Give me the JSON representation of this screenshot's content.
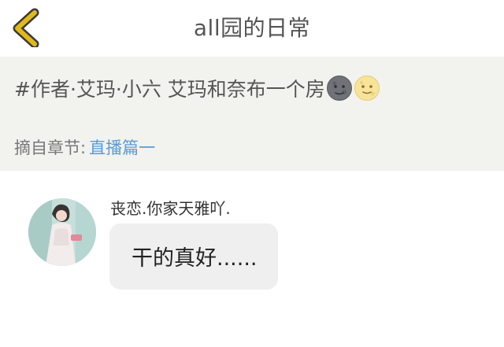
{
  "header": {
    "title": "all园的日常",
    "back_icon": "chevron-left-icon",
    "accent_color": "#e2b81a"
  },
  "quote": {
    "text": "#作者·艾玛·小六 艾玛和奈布一个房",
    "emojis": [
      "new-moon-face-icon",
      "full-moon-face-icon"
    ],
    "source_label": "摘自章节:",
    "source_link": "直播篇一",
    "link_color": "#5b9bd5",
    "panel_color": "#f2f2ee"
  },
  "comment": {
    "username": "丧恋.你家天雅吖.",
    "text": "干的真好......",
    "avatar": "user-avatar-photo"
  }
}
